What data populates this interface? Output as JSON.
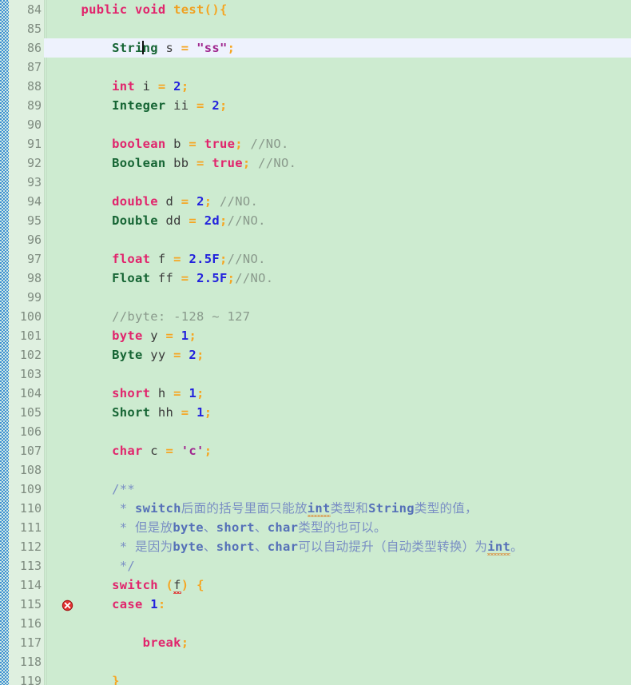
{
  "editor": {
    "language": "Java",
    "first_line": 84,
    "last_line": 119,
    "current_line": 86,
    "error_line": 114,
    "colors": {
      "background": "#cdebd0",
      "gutter": "#dff0e0",
      "current_line": "#eef2fd",
      "marker_strip": "#3d8fd1",
      "keyword": "#e1246c",
      "type": "#166534",
      "number": "#2222dd",
      "string": "#a0278f",
      "operator": "#f5a623",
      "comment": "#8a9a8c",
      "javadoc": "#7a8fc4",
      "javadoc_code": "#5570b8",
      "method_name": "#f0a020",
      "line_number": "#7f8c80",
      "error_marker": "#e03030"
    },
    "gutter_icons": {
      "line_114": "error-icon"
    },
    "lines": [
      {
        "n": "84",
        "text": "    public void test(){"
      },
      {
        "n": "85",
        "text": ""
      },
      {
        "n": "86",
        "text": "        String s = \"ss\";"
      },
      {
        "n": "87",
        "text": ""
      },
      {
        "n": "88",
        "text": "        int i = 2;"
      },
      {
        "n": "89",
        "text": "        Integer ii = 2;"
      },
      {
        "n": "90",
        "text": ""
      },
      {
        "n": "91",
        "text": "        boolean b = true; //NO."
      },
      {
        "n": "92",
        "text": "        Boolean bb = true; //NO."
      },
      {
        "n": "93",
        "text": ""
      },
      {
        "n": "94",
        "text": "        double d = 2; //NO."
      },
      {
        "n": "95",
        "text": "        Double dd = 2d;//NO."
      },
      {
        "n": "96",
        "text": ""
      },
      {
        "n": "97",
        "text": "        float f = 2.5F;//NO."
      },
      {
        "n": "98",
        "text": "        Float ff = 2.5F;//NO."
      },
      {
        "n": "99",
        "text": ""
      },
      {
        "n": "100",
        "text": "        //byte: -128 ~ 127"
      },
      {
        "n": "101",
        "text": "        byte y = 1;"
      },
      {
        "n": "102",
        "text": "        Byte yy = 2;"
      },
      {
        "n": "103",
        "text": ""
      },
      {
        "n": "104",
        "text": "        short h = 1;"
      },
      {
        "n": "105",
        "text": "        Short hh = 1;"
      },
      {
        "n": "106",
        "text": ""
      },
      {
        "n": "107",
        "text": "        char c = 'c';"
      },
      {
        "n": "108",
        "text": ""
      },
      {
        "n": "109",
        "text": "        /**"
      },
      {
        "n": "110",
        "text": "         * switch后面的括号里面只能放int类型和String类型的值，"
      },
      {
        "n": "111",
        "text": "         * 但是放byte、short、char类型的也可以。"
      },
      {
        "n": "112",
        "text": "         * 是因为byte、short、char可以自动提升（自动类型转换）为int。"
      },
      {
        "n": "113",
        "text": "         */"
      },
      {
        "n": "114",
        "text": "        switch (f) {"
      },
      {
        "n": "115",
        "text": "        case 1:"
      },
      {
        "n": "116",
        "text": ""
      },
      {
        "n": "117",
        "text": "            break;"
      },
      {
        "n": "118",
        "text": ""
      },
      {
        "n": "119",
        "text": "        }"
      }
    ],
    "tokens": {
      "kw_public": "public",
      "kw_void": "void",
      "method_test": "test",
      "type_String": "String",
      "type_Integer": "Integer",
      "type_Boolean": "Boolean",
      "type_Double": "Double",
      "type_Float": "Float",
      "type_Byte": "Byte",
      "type_Short": "Short",
      "kw_int": "int",
      "kw_boolean": "boolean",
      "kw_double": "double",
      "kw_float": "float",
      "kw_byte": "byte",
      "kw_short": "short",
      "kw_char": "char",
      "kw_true": "true",
      "kw_switch": "switch",
      "kw_case": "case",
      "kw_break": "break",
      "str_ss": "\"ss\"",
      "str_c": "'c'",
      "comment_NO": "//NO.",
      "comment_byte_range": "//byte: -128 ~ 127",
      "doc_open": "/**",
      "doc_close": "*/",
      "doc_l110_a": "switch",
      "doc_l110_b": "后面的括号里面只能放",
      "doc_l110_c": "int",
      "doc_l110_d": "类型和",
      "doc_l110_e": "String",
      "doc_l110_f": "类型的值，",
      "doc_l111_a": "但是放",
      "doc_l111_b": "byte",
      "doc_l111_c": "、",
      "doc_l111_d": "short",
      "doc_l111_e": "、",
      "doc_l111_f": "char",
      "doc_l111_g": "类型的也可以。",
      "doc_l112_a": "是因为",
      "doc_l112_b": "byte",
      "doc_l112_c": "、",
      "doc_l112_d": "short",
      "doc_l112_e": "、",
      "doc_l112_f": "char",
      "doc_l112_g": "可以自动提升（自动类型转换）为",
      "doc_l112_h": "int",
      "doc_l112_i": "。",
      "var_s": "s",
      "var_i": "i",
      "var_ii": "ii",
      "var_b": "b",
      "var_bb": "bb",
      "var_d": "d",
      "var_dd": "dd",
      "var_f": "f",
      "var_ff": "ff",
      "var_y": "y",
      "var_yy": "yy",
      "var_h": "h",
      "var_hh": "hh",
      "var_c": "c",
      "lit_2": "2",
      "lit_2d": "2d",
      "lit_2_5F": "2.5F",
      "lit_1": "1",
      "case_1": "1",
      "op_eq": "=",
      "op_semi": ";",
      "op_lbrace": "{",
      "op_rbrace": "}",
      "op_lparen": "(",
      "op_rparen": ")",
      "op_colon": ":",
      "star": "*"
    }
  }
}
